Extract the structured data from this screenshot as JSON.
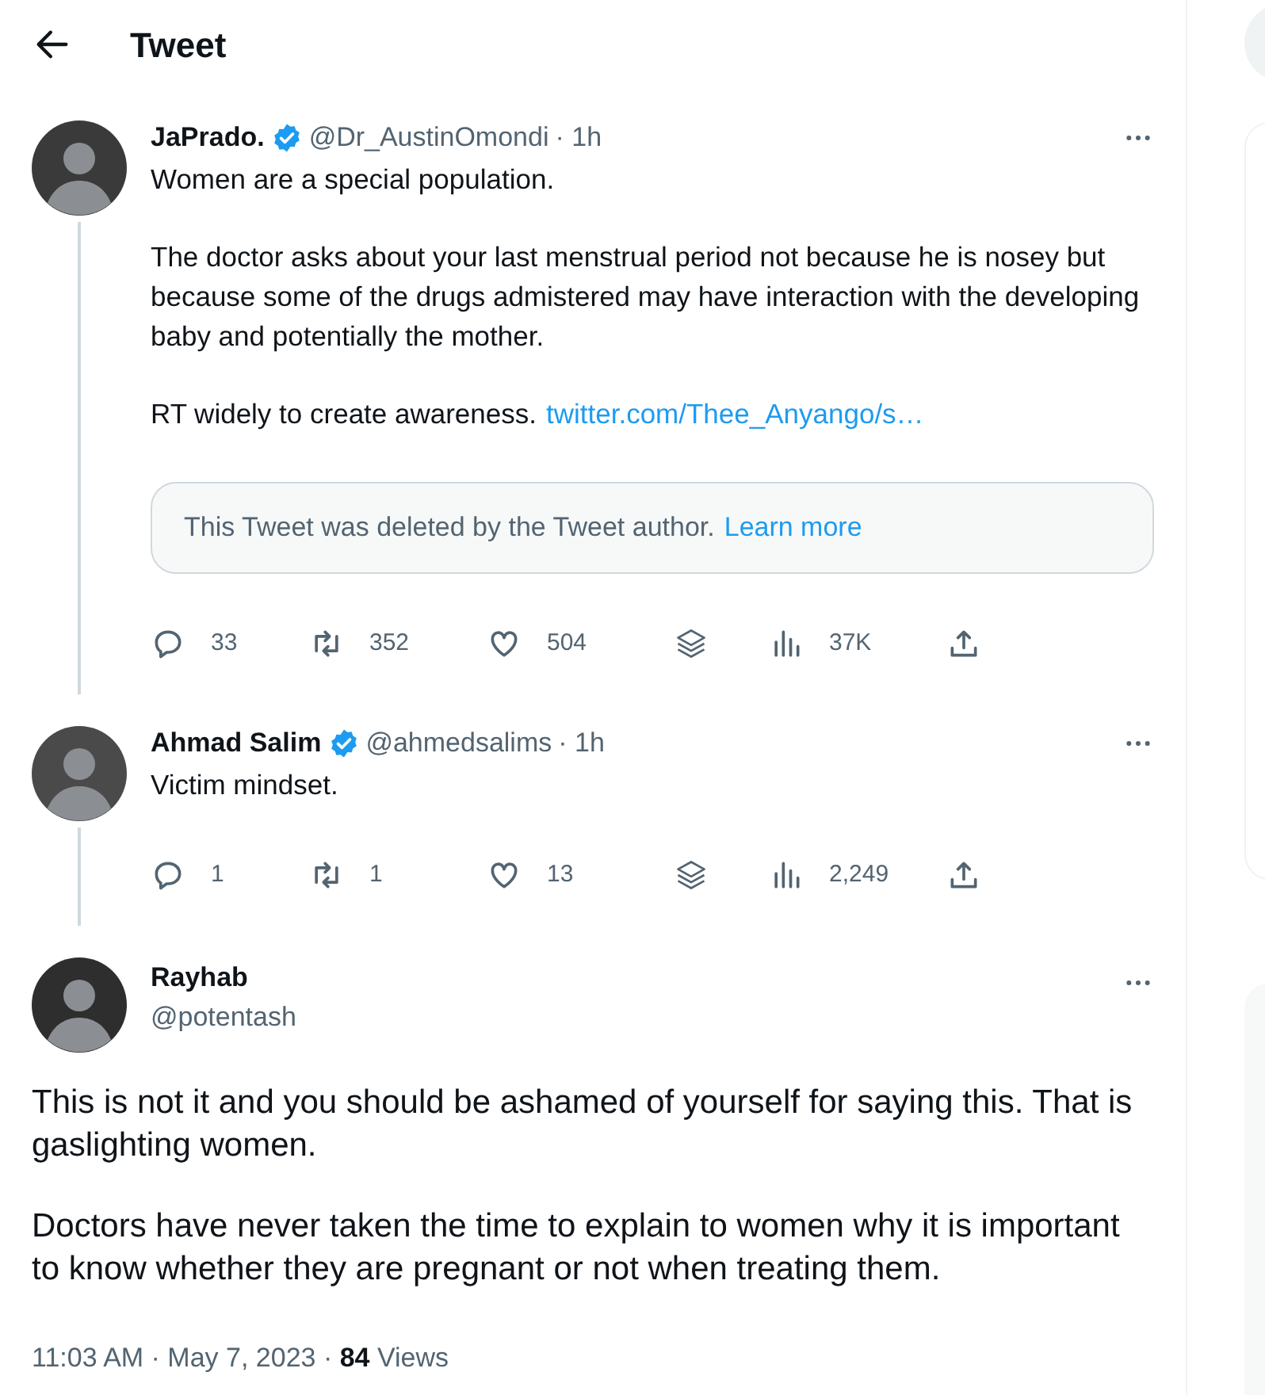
{
  "header": {
    "title": "Tweet"
  },
  "thread": [
    {
      "name": "JaPrado.",
      "verified": true,
      "handle": "@Dr_AustinOmondi",
      "time": "· 1h",
      "paragraphs": [
        {
          "text": "Women are a special population."
        },
        {
          "text": "The doctor asks about your last menstrual period not because he is nosey but because some of the drugs admistered may have interaction with the developing baby and potentially the mother."
        },
        {
          "text": "RT widely to create awareness.",
          "link": "twitter.com/Thee_Anyango/s…"
        }
      ],
      "quoted": {
        "text": "This Tweet was deleted by the Tweet author.",
        "link": "Learn more"
      },
      "actions": [
        {
          "kind": "reply",
          "count": "33"
        },
        {
          "kind": "retweet",
          "count": "352"
        },
        {
          "kind": "like",
          "count": "504"
        },
        {
          "kind": "stack"
        },
        {
          "kind": "views",
          "count": "37K"
        },
        {
          "kind": "share"
        }
      ]
    },
    {
      "name": "Ahmad Salim",
      "verified": true,
      "handle": "@ahmedsalims",
      "time": "· 1h",
      "paragraphs": [
        {
          "text": "Victim mindset."
        }
      ],
      "actions": [
        {
          "kind": "reply",
          "count": "1"
        },
        {
          "kind": "retweet",
          "count": "1"
        },
        {
          "kind": "like",
          "count": "13"
        },
        {
          "kind": "stack"
        },
        {
          "kind": "views",
          "count": "2,249"
        },
        {
          "kind": "share"
        }
      ]
    }
  ],
  "main_tweet": {
    "name": "Rayhab",
    "handle": "@potentash",
    "paragraphs": [
      "This is not it and you should be ashamed of yourself for saying this. That is gaslighting women.",
      "Doctors have never taken the time to explain to women why it is important to know whether they are pregnant or not when treating them."
    ],
    "meta": "11:03 AM · May 7, 2023 · **84** Views"
  }
}
